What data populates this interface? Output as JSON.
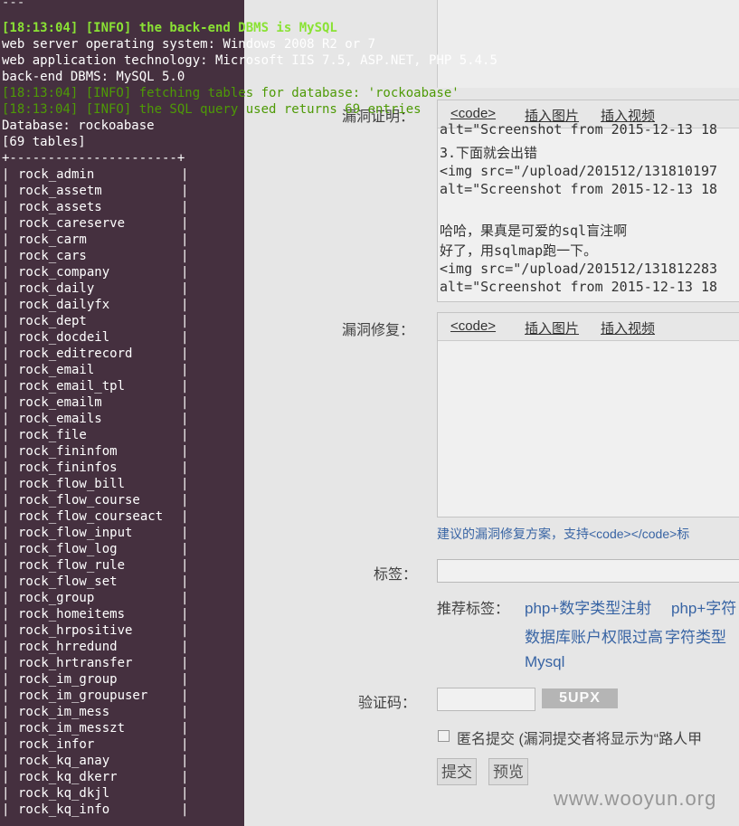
{
  "terminal": {
    "lines": [
      {
        "text": "---",
        "kind": "dim"
      },
      {
        "text": "[18:13:04] [INFO] the back-end DBMS is MySQL",
        "kind": "info"
      },
      {
        "text": "web server operating system: Windows 2008 R2 or 7",
        "kind": "plain"
      },
      {
        "text": "web application technology: Microsoft IIS 7.5, ASP.NET, PHP 5.4.5",
        "kind": "plain"
      },
      {
        "text": "back-end DBMS: MySQL 5.0",
        "kind": "plain"
      },
      {
        "text": "[18:13:04] [INFO] fetching tables for database: 'rockoabase'",
        "kind": "info2"
      },
      {
        "text": "[18:13:04] [INFO] the SQL query used returns 69 entries",
        "kind": "info2"
      },
      {
        "text": "Database: rockoabase",
        "kind": "plain"
      },
      {
        "text": "[69 tables]",
        "kind": "plain"
      },
      {
        "text": "+----------------------+",
        "kind": "plain"
      }
    ],
    "tables": [
      "rock_admin",
      "rock_assetm",
      "rock_assets",
      "rock_careserve",
      "rock_carm",
      "rock_cars",
      "rock_company",
      "rock_daily",
      "rock_dailyfx",
      "rock_dept",
      "rock_docdeil",
      "rock_editrecord",
      "rock_email",
      "rock_email_tpl",
      "rock_emailm",
      "rock_emails",
      "rock_file",
      "rock_fininfom",
      "rock_fininfos",
      "rock_flow_bill",
      "rock_flow_course",
      "rock_flow_courseact",
      "rock_flow_input",
      "rock_flow_log",
      "rock_flow_rule",
      "rock_flow_set",
      "rock_group",
      "rock_homeitems",
      "rock_hrpositive",
      "rock_hrredund",
      "rock_hrtransfer",
      "rock_im_group",
      "rock_im_groupuser",
      "rock_im_mess",
      "rock_im_messzt",
      "rock_infor",
      "rock_kq_anay",
      "rock_kq_dkerr",
      "rock_kq_dkjl",
      "rock_kq_info"
    ]
  },
  "form": {
    "proof_label": "漏洞证明：",
    "toolbar_code": "<code>",
    "toolbar_image": "插入图片",
    "toolbar_video": "插入视频",
    "proof_lines": [
      "alt=\"Screenshot from 2015-12-13 18",
      "3.下面就会出错",
      "<img src=\"/upload/201512/131810197",
      "alt=\"Screenshot from 2015-12-13 18",
      "",
      "哈哈，果真是可爱的sql盲注啊",
      "好了，用sqlmap跑一下。",
      "<img src=\"/upload/201512/131812283",
      "alt=\"Screenshot from 2015-12-13 18"
    ],
    "fix_label": "漏洞修复：",
    "fix_hint": "建议的漏洞修复方案，支持<code></code>标",
    "tags_label": "标签：",
    "recommended_label": "推荐标签：",
    "recommended_tags": [
      "php+数字类型注射",
      "php+字符",
      "数据库账户权限过高",
      "字符类型",
      "Mysql"
    ],
    "captcha_label": "验证码：",
    "captcha_text": "5UPX",
    "anon_label": "匿名提交 (漏洞提交者将显示为“路人甲",
    "submit_label": "提交",
    "preview_label": "预览"
  },
  "watermark": "www.wooyun.org"
}
